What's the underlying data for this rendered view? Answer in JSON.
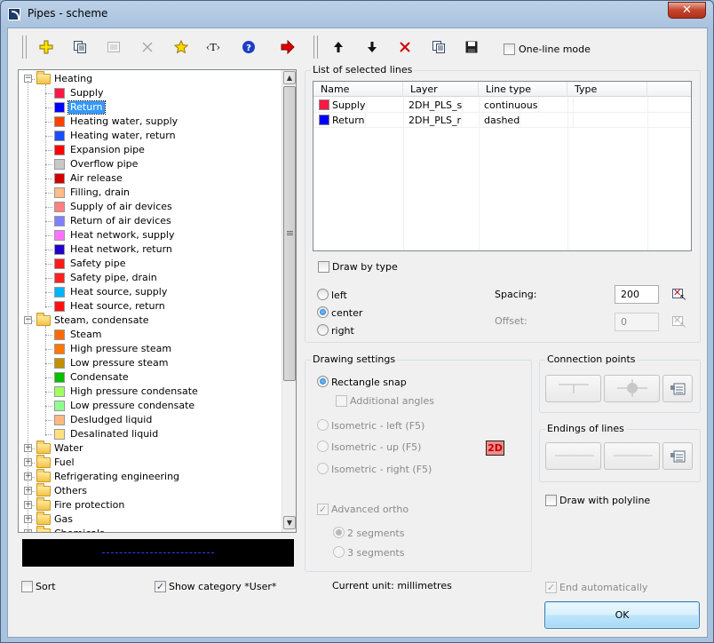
{
  "window": {
    "title": "Pipes - scheme",
    "close_glyph": "✕"
  },
  "toolbar": {
    "one_line_mode_label": "One-line mode",
    "one_line_mode_checked": false,
    "text_tool_glyph": "‹T›"
  },
  "tree": {
    "items": [
      {
        "kind": "group",
        "label": "Heating",
        "expanded": true
      },
      {
        "kind": "item",
        "label": "Supply",
        "color": "#ff1744"
      },
      {
        "kind": "item",
        "label": "Return",
        "color": "#0000ff",
        "selected": true
      },
      {
        "kind": "item",
        "label": "Heating water, supply",
        "color": "#ff4000"
      },
      {
        "kind": "item",
        "label": "Heating water, return",
        "color": "#1a4dff"
      },
      {
        "kind": "item",
        "label": "Expansion pipe",
        "color": "#ff0000"
      },
      {
        "kind": "item",
        "label": "Overflow pipe",
        "color": "#c8c8c8"
      },
      {
        "kind": "item",
        "label": "Air release",
        "color": "#d40000"
      },
      {
        "kind": "item",
        "label": "Filling, drain",
        "color": "#ffbb88"
      },
      {
        "kind": "item",
        "label": "Supply of air devices",
        "color": "#ff8080"
      },
      {
        "kind": "item",
        "label": "Return of air devices",
        "color": "#8080ff"
      },
      {
        "kind": "item",
        "label": "Heat network, supply",
        "color": "#ff70ff"
      },
      {
        "kind": "item",
        "label": "Heat network, return",
        "color": "#2200cc"
      },
      {
        "kind": "item",
        "label": "Safety pipe",
        "color": "#ff1a1a"
      },
      {
        "kind": "item",
        "label": "Safety pipe, drain",
        "color": "#ff2020"
      },
      {
        "kind": "item",
        "label": "Heat source, supply",
        "color": "#00b4ff"
      },
      {
        "kind": "item",
        "label": "Heat source, return",
        "color": "#ff1010"
      },
      {
        "kind": "group",
        "label": "Steam, condensate",
        "expanded": true
      },
      {
        "kind": "item",
        "label": "Steam",
        "color": "#ff6a00"
      },
      {
        "kind": "item",
        "label": "High pressure steam",
        "color": "#ff7700"
      },
      {
        "kind": "item",
        "label": "Low pressure steam",
        "color": "#c09000"
      },
      {
        "kind": "item",
        "label": "Condensate",
        "color": "#00c000"
      },
      {
        "kind": "item",
        "label": "High pressure condensate",
        "color": "#a0ff60"
      },
      {
        "kind": "item",
        "label": "Low pressure condensate",
        "color": "#90ff90"
      },
      {
        "kind": "item",
        "label": "Desludged liquid",
        "color": "#ffb880"
      },
      {
        "kind": "item",
        "label": "Desalinated liquid",
        "color": "#ffe080"
      },
      {
        "kind": "group",
        "label": "Water",
        "expanded": false
      },
      {
        "kind": "group",
        "label": "Fuel",
        "expanded": false
      },
      {
        "kind": "group",
        "label": "Refrigerating engineering",
        "expanded": false
      },
      {
        "kind": "group",
        "label": "Others",
        "expanded": false
      },
      {
        "kind": "group",
        "label": "Fire protection",
        "expanded": false
      },
      {
        "kind": "group",
        "label": "Gas",
        "expanded": false
      },
      {
        "kind": "group",
        "label": "Chemicals",
        "expanded": false
      }
    ]
  },
  "selected_lines": {
    "title": "List of selected lines",
    "columns": [
      "Name",
      "Layer",
      "Line type",
      "Type"
    ],
    "rows": [
      {
        "name": "Supply",
        "color": "#ff1744",
        "layer": "2DH_PLS_s",
        "line_type": "continuous",
        "type": ""
      },
      {
        "name": "Return",
        "color": "#0000ff",
        "layer": "2DH_PLS_r",
        "line_type": "dashed",
        "type": ""
      }
    ]
  },
  "options": {
    "draw_by_type": "Draw by type",
    "left": "left",
    "center": "center",
    "right": "right",
    "alignment": "center",
    "spacing_label": "Spacing:",
    "spacing_value": "200",
    "offset_label": "Offset:",
    "offset_value": "0"
  },
  "drawing_settings": {
    "title": "Drawing settings",
    "rectangle_snap": "Rectangle snap",
    "additional_angles": "Additional angles",
    "iso_left": "Isometric - left (F5)",
    "iso_up": "Isometric - up (F5)",
    "iso_right": "Isometric - right (F5)",
    "mode_badge": "2D",
    "advanced_ortho": "Advanced ortho",
    "two_segments": "2 segments",
    "three_segments": "3 segments"
  },
  "connection_points": {
    "title": "Connection points"
  },
  "endings": {
    "title": "Endings of lines"
  },
  "draw_with_polyline": "Draw with polyline",
  "bottom": {
    "sort": "Sort",
    "show_category": "Show category *User*",
    "current_unit": "Current unit: millimetres",
    "end_automatically": "End automatically",
    "ok": "OK"
  },
  "colors": {
    "accent": "#3399ff",
    "preview_background": "#000000",
    "preview_line": "#2f3cff"
  }
}
